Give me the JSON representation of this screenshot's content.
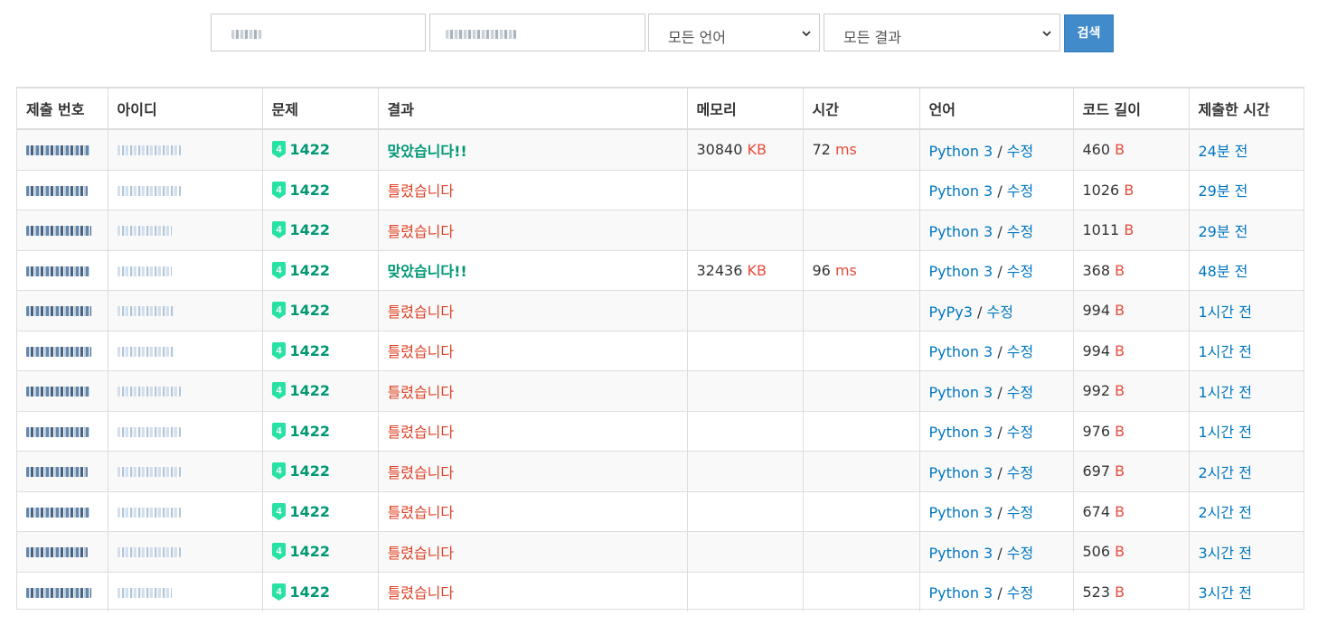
{
  "filters": {
    "language_select": "모든 언어",
    "result_select": "모든 결과",
    "search_button": "검색"
  },
  "table": {
    "headers": [
      "제출 번호",
      "아이디",
      "문제",
      "결과",
      "메모리",
      "시간",
      "언어",
      "코드 길이",
      "제출한 시간"
    ],
    "rows": [
      {
        "problem": "1422",
        "result": "맞았습니다!!",
        "result_type": "ac",
        "memory": "30840",
        "memory_unit": "KB",
        "time": "72",
        "time_unit": "ms",
        "language": "Python 3",
        "edit": "수정",
        "code_length": "460",
        "length_unit": "B",
        "submitted": "24분 전"
      },
      {
        "problem": "1422",
        "result": "틀렸습니다",
        "result_type": "wa",
        "memory": "",
        "memory_unit": "",
        "time": "",
        "time_unit": "",
        "language": "Python 3",
        "edit": "수정",
        "code_length": "1026",
        "length_unit": "B",
        "submitted": "29분 전"
      },
      {
        "problem": "1422",
        "result": "틀렸습니다",
        "result_type": "wa",
        "memory": "",
        "memory_unit": "",
        "time": "",
        "time_unit": "",
        "language": "Python 3",
        "edit": "수정",
        "code_length": "1011",
        "length_unit": "B",
        "submitted": "29분 전"
      },
      {
        "problem": "1422",
        "result": "맞았습니다!!",
        "result_type": "ac",
        "memory": "32436",
        "memory_unit": "KB",
        "time": "96",
        "time_unit": "ms",
        "language": "Python 3",
        "edit": "수정",
        "code_length": "368",
        "length_unit": "B",
        "submitted": "48분 전"
      },
      {
        "problem": "1422",
        "result": "틀렸습니다",
        "result_type": "wa",
        "memory": "",
        "memory_unit": "",
        "time": "",
        "time_unit": "",
        "language": "PyPy3",
        "edit": "수정",
        "code_length": "994",
        "length_unit": "B",
        "submitted": "1시간 전"
      },
      {
        "problem": "1422",
        "result": "틀렸습니다",
        "result_type": "wa",
        "memory": "",
        "memory_unit": "",
        "time": "",
        "time_unit": "",
        "language": "Python 3",
        "edit": "수정",
        "code_length": "994",
        "length_unit": "B",
        "submitted": "1시간 전"
      },
      {
        "problem": "1422",
        "result": "틀렸습니다",
        "result_type": "wa",
        "memory": "",
        "memory_unit": "",
        "time": "",
        "time_unit": "",
        "language": "Python 3",
        "edit": "수정",
        "code_length": "992",
        "length_unit": "B",
        "submitted": "1시간 전"
      },
      {
        "problem": "1422",
        "result": "틀렸습니다",
        "result_type": "wa",
        "memory": "",
        "memory_unit": "",
        "time": "",
        "time_unit": "",
        "language": "Python 3",
        "edit": "수정",
        "code_length": "976",
        "length_unit": "B",
        "submitted": "1시간 전"
      },
      {
        "problem": "1422",
        "result": "틀렸습니다",
        "result_type": "wa",
        "memory": "",
        "memory_unit": "",
        "time": "",
        "time_unit": "",
        "language": "Python 3",
        "edit": "수정",
        "code_length": "697",
        "length_unit": "B",
        "submitted": "2시간 전"
      },
      {
        "problem": "1422",
        "result": "틀렸습니다",
        "result_type": "wa",
        "memory": "",
        "memory_unit": "",
        "time": "",
        "time_unit": "",
        "language": "Python 3",
        "edit": "수정",
        "code_length": "674",
        "length_unit": "B",
        "submitted": "2시간 전"
      },
      {
        "problem": "1422",
        "result": "틀렸습니다",
        "result_type": "wa",
        "memory": "",
        "memory_unit": "",
        "time": "",
        "time_unit": "",
        "language": "Python 3",
        "edit": "수정",
        "code_length": "506",
        "length_unit": "B",
        "submitted": "3시간 전"
      },
      {
        "problem": "1422",
        "result": "틀렸습니다",
        "result_type": "wa",
        "memory": "",
        "memory_unit": "",
        "time": "",
        "time_unit": "",
        "language": "Python 3",
        "edit": "수정",
        "code_length": "523",
        "length_unit": "B",
        "submitted": "3시간 전"
      }
    ]
  },
  "colors": {
    "accepted": "#009874",
    "wrong": "#dd4124",
    "unit": "#e74c3c",
    "link": "#0076c0",
    "search_button": "#428bca",
    "tier_badge": "#27e2a4"
  },
  "icons": {
    "tier": "tier-4-badge-icon",
    "chevron": "chevron-down-icon"
  },
  "tier_level": "4"
}
